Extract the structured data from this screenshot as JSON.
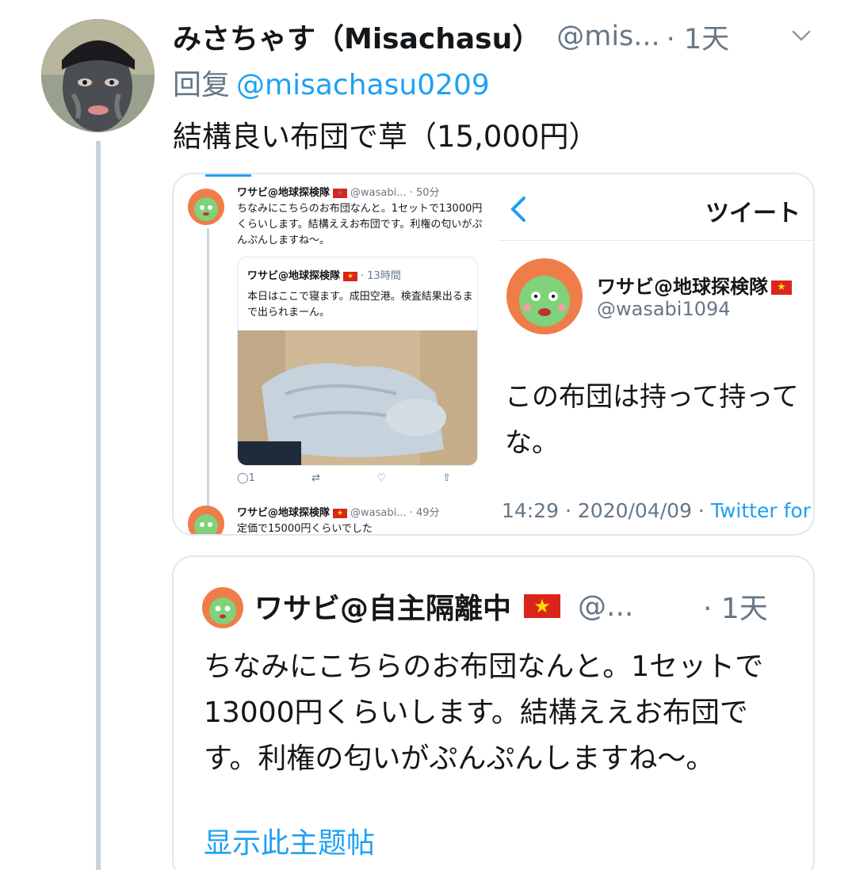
{
  "tweet": {
    "display_name": "みさちゃす（Misachasu）",
    "handle": "@mis...",
    "time": "· 1天",
    "replying_prefix": "回复",
    "replying_to": "@misachasu0209",
    "text": "結構良い布団で草（15,000円）"
  },
  "media_left": {
    "tweet1_name": "ワサビ@地球探検隊",
    "tweet1_handle": "@wasabi... · 50分",
    "tweet1_text": "ちなみにこちらのお布団なんと。1セットで13000円くらいします。結構ええお布団です。利権の匂いがぷんぷんしますね〜。",
    "quoted_name": "ワサビ@地球探検隊",
    "quoted_time": "· 13時間",
    "quoted_text": "本日はここで寝ます。成田空港。検査結果出るまで出られまーん。",
    "reply_count": "1",
    "tweet2_name": "ワサビ@地球探検隊",
    "tweet2_handle": "@wasabi... · 49分",
    "tweet2_text": "定価で15000円くらいでした"
  },
  "media_right": {
    "nav_title": "ツイート",
    "name": "ワサビ@地球探検隊",
    "handle": "@wasabi1094",
    "text_line1": "この布団は持って持って",
    "text_line2": "な。",
    "meta": "14:29 · 2020/04/09 · ",
    "source": "Twitter for"
  },
  "quote": {
    "name": "ワサビ@自主隔離中",
    "flag": "★",
    "handle": "@...",
    "time": "· 1天",
    "text": "ちなみにこちらのお布団なんと。1セットで13000円くらいします。結構ええお布団です。利権の匂いがぷんぷんしますね〜。",
    "show_thread": "显示此主题帖"
  },
  "icons": [
    "chevron-down-icon",
    "reply-icon",
    "retweet-icon",
    "like-icon",
    "share-icon",
    "back-arrow-icon"
  ],
  "colors": {
    "link": "#1da1f2",
    "secondary": "#657786",
    "border": "#e1e8ed",
    "thread": "#c6d3de"
  }
}
